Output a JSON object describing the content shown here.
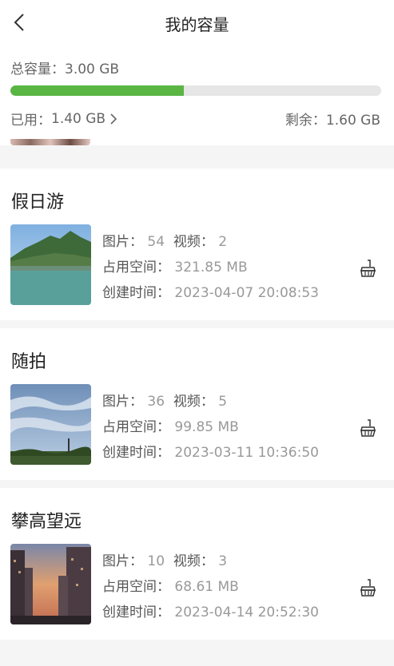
{
  "header": {
    "title": "我的容量"
  },
  "storage": {
    "total_label": "总容量：",
    "total_value": "3.00 GB",
    "used_label": "已用：",
    "used_value": "1.40 GB",
    "remaining_label": "剩余：",
    "remaining_value": "1.60 GB",
    "used_fraction": 0.467,
    "bar_color": "#5ab543",
    "track_color": "#e6e6e6"
  },
  "labels": {
    "photos": "图片：",
    "videos": "视频：",
    "space": "占用空间：",
    "created": "创建时间："
  },
  "albums": [
    {
      "name": "假日游",
      "photos": "54",
      "videos": "2",
      "space": "321.85 MB",
      "created": "2023-04-07 20:08:53"
    },
    {
      "name": "随拍",
      "photos": "36",
      "videos": "5",
      "space": "99.85 MB",
      "created": "2023-03-11 10:36:50"
    },
    {
      "name": "攀高望远",
      "photos": "10",
      "videos": "3",
      "space": "68.61 MB",
      "created": "2023-04-14 20:52:30"
    }
  ],
  "icons": {
    "back": "chevron-left-icon",
    "used_more": "chevron-right-icon",
    "clean": "broom-icon"
  }
}
